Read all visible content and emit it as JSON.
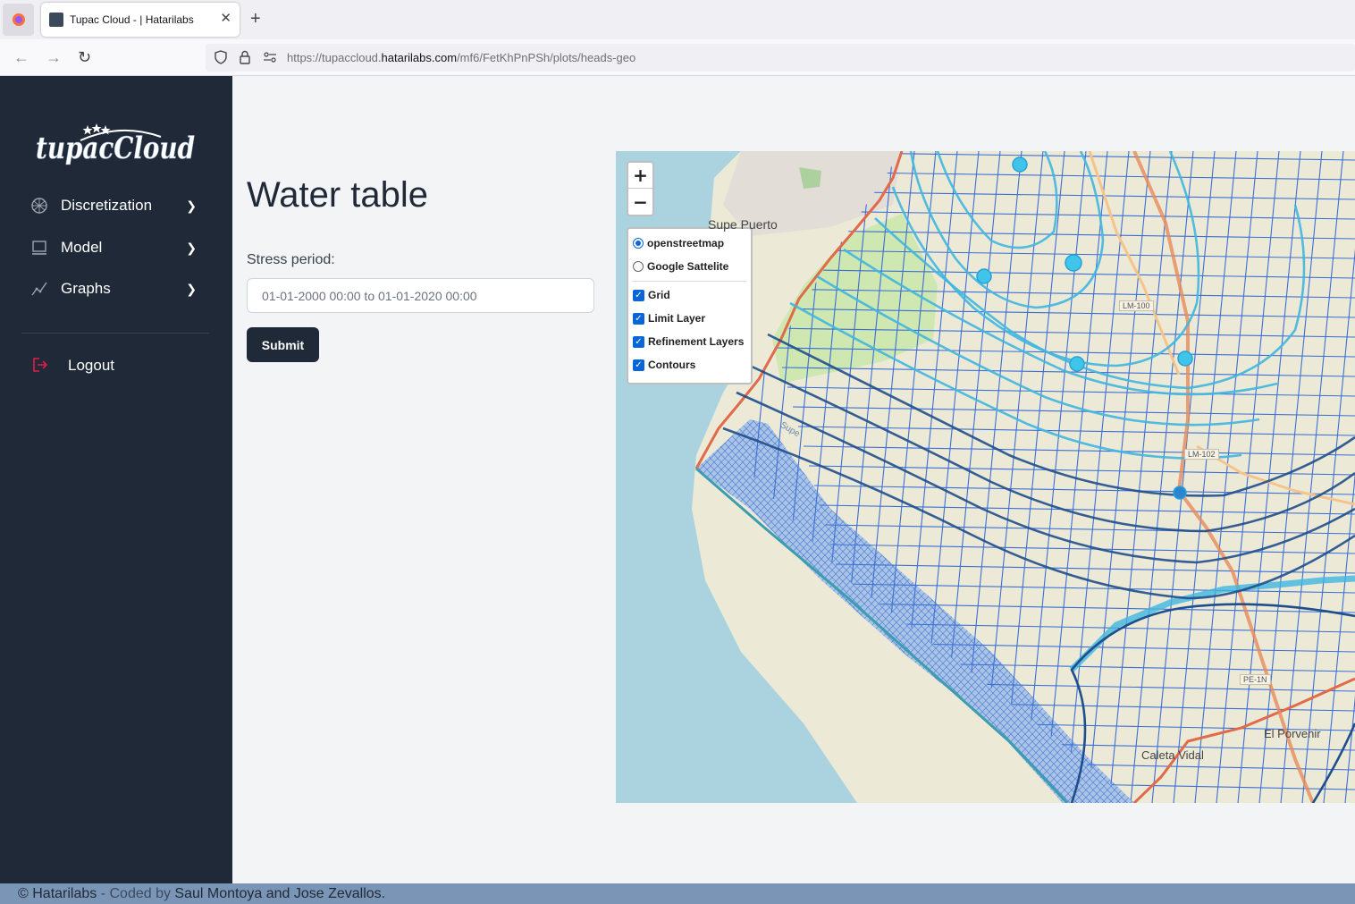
{
  "browser": {
    "tab_title": "Tupac Cloud - | Hatarilabs",
    "url_prefix": "https://tupaccloud.",
    "url_host": "hatarilabs.com",
    "url_path": "/mf6/FetKhPnPSh/plots/heads-geo"
  },
  "sidebar": {
    "logo_text": "tupacCloud",
    "items": [
      {
        "label": "Discretization",
        "icon": "grid-globe-icon"
      },
      {
        "label": "Model",
        "icon": "laptop-icon"
      },
      {
        "label": "Graphs",
        "icon": "line-chart-icon"
      }
    ],
    "logout_label": "Logout"
  },
  "main": {
    "title": "Water table",
    "stress_label": "Stress period:",
    "stress_value": "01-01-2000 00:00 to 01-01-2020 00:00",
    "submit_label": "Submit"
  },
  "map": {
    "zoom_in": "+",
    "zoom_out": "−",
    "base_layers": [
      {
        "label": "openstreetmap",
        "selected": true
      },
      {
        "label": "Google Sattelite",
        "selected": false
      }
    ],
    "overlays": [
      {
        "label": "Grid",
        "checked": true
      },
      {
        "label": "Limit Layer",
        "checked": true
      },
      {
        "label": "Refinement Layers",
        "checked": true
      },
      {
        "label": "Contours",
        "checked": true
      }
    ],
    "place_labels": {
      "supe_puerto": "Supe Puerto",
      "caleta_vidal": "Caleta Vidal",
      "el_porvenir": "El Porvenir",
      "supe": "Supe"
    },
    "road_labels": {
      "lm100": "LM-100",
      "lm102": "LM-102",
      "pe1n": "PE-1N"
    },
    "colors": {
      "sea": "#aad3df",
      "land": "#f2efd9",
      "grid": "#3a6fd6",
      "limit": "#e06a4a",
      "contour_dark": "#1f4e8c",
      "contour_light": "#3fb6e0"
    }
  },
  "footer": {
    "copyright": "© Hatarilabs",
    "coded_by": " - Coded by ",
    "authors": "Saul Montoya and Jose Zevallos."
  }
}
